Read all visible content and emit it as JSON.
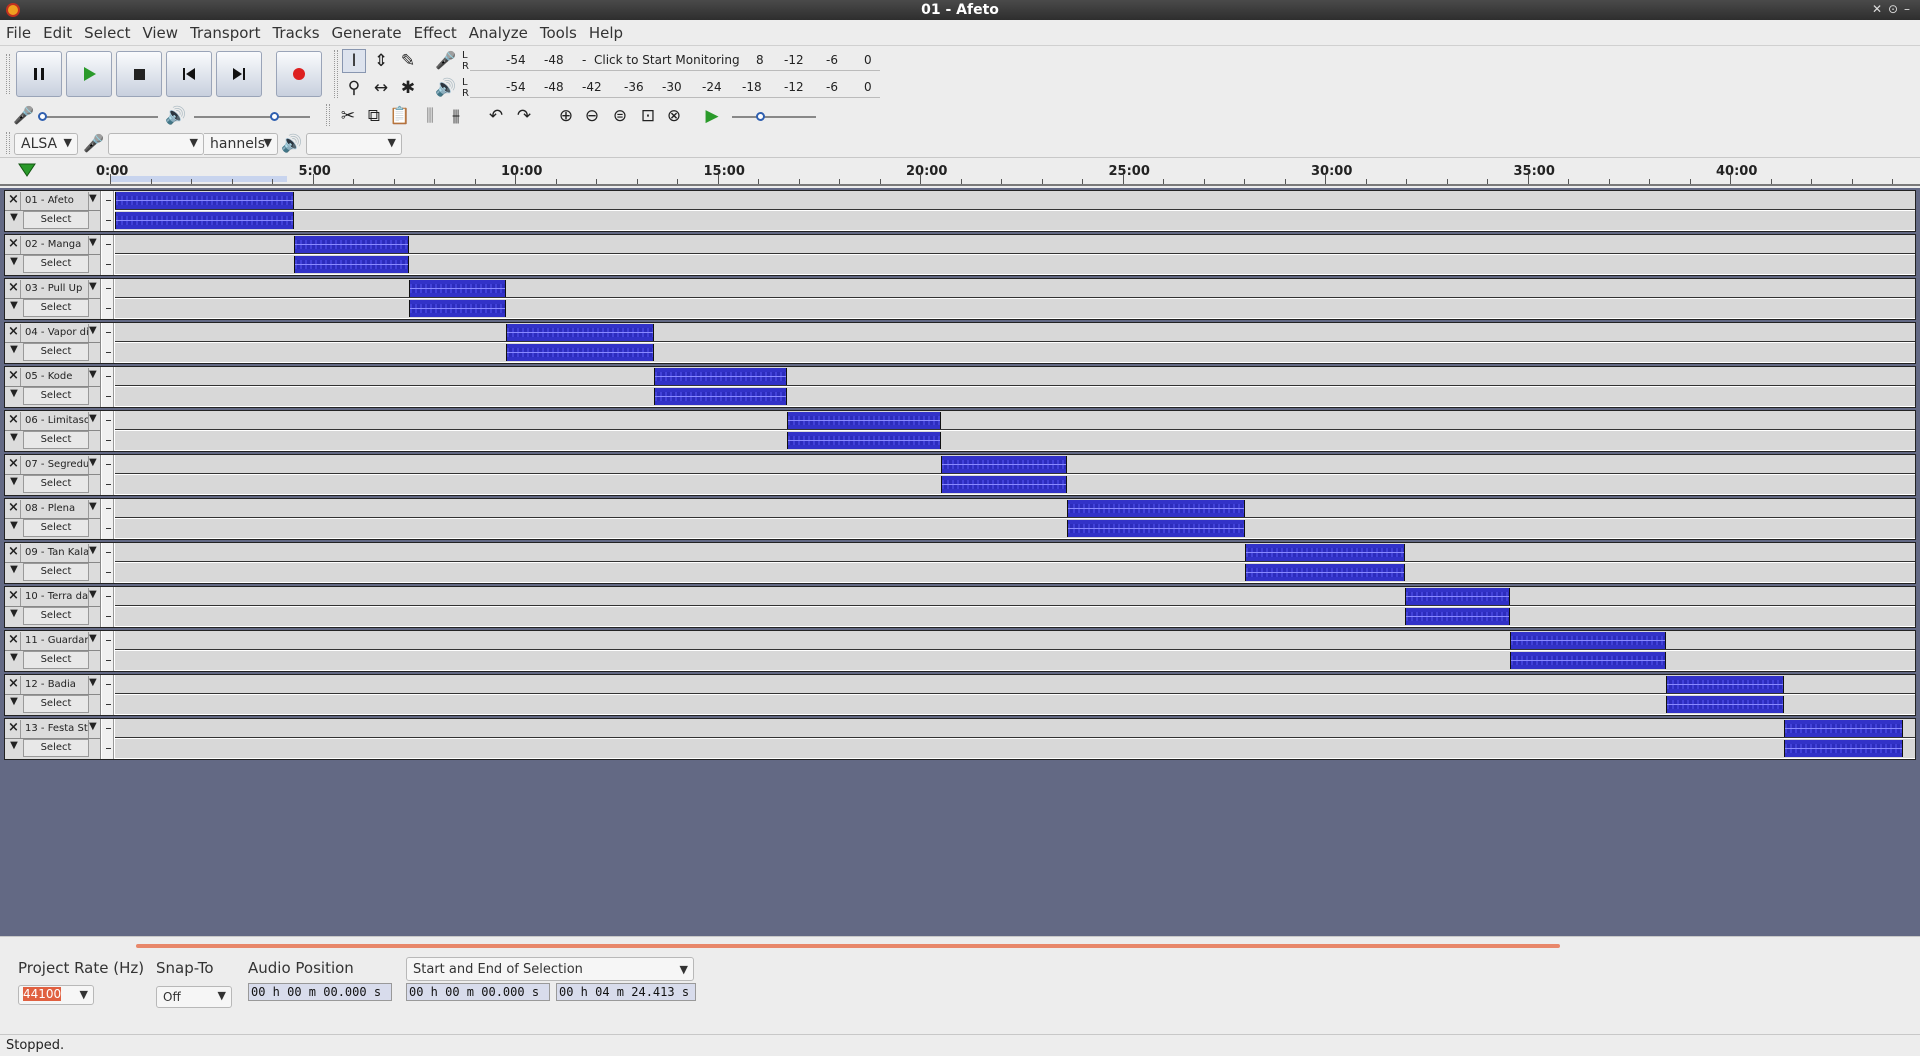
{
  "window": {
    "title": "01 - Afeto"
  },
  "menu": [
    "File",
    "Edit",
    "Select",
    "View",
    "Transport",
    "Tracks",
    "Generate",
    "Effect",
    "Analyze",
    "Tools",
    "Help"
  ],
  "meters": {
    "record_prompt": "Click to Start Monitoring",
    "record_ticks": [
      "-54",
      "-48",
      "8",
      "-12",
      "-6",
      "0"
    ],
    "playback_ticks": [
      "-54",
      "-48",
      "-42",
      "-36",
      "-30",
      "-24",
      "-18",
      "-12",
      "-6",
      "0"
    ],
    "channel_L": "L",
    "channel_R": "R"
  },
  "device": {
    "host": "ALSA",
    "channels": "hannels"
  },
  "ruler": {
    "labels": [
      "0:00",
      "5:00",
      "10:00",
      "15:00",
      "20:00",
      "25:00",
      "30:00",
      "35:00",
      "40:00"
    ],
    "total_minutes": 44.3
  },
  "tracks": [
    {
      "name": "01 - Afeto",
      "start_min": 0.0,
      "end_min": 4.41
    },
    {
      "name": "02 - Manga",
      "start_min": 4.41,
      "end_min": 7.25
    },
    {
      "name": "03 - Pull Up",
      "start_min": 7.25,
      "end_min": 9.65
    },
    {
      "name": "04 - Vapor di",
      "start_min": 9.65,
      "end_min": 13.3
    },
    {
      "name": "05 - Kode",
      "start_min": 13.3,
      "end_min": 16.6
    },
    {
      "name": "06 - Limitaso",
      "start_min": 16.6,
      "end_min": 20.4
    },
    {
      "name": "07 - Segredu",
      "start_min": 20.4,
      "end_min": 23.5
    },
    {
      "name": "08 - Plena",
      "start_min": 23.5,
      "end_min": 27.9
    },
    {
      "name": "09 - Tan Kala",
      "start_min": 27.9,
      "end_min": 31.85
    },
    {
      "name": "10 - Terra da",
      "start_min": 31.85,
      "end_min": 34.45
    },
    {
      "name": "11 - Guardar",
      "start_min": 34.45,
      "end_min": 38.3
    },
    {
      "name": "12 - Badia",
      "start_min": 38.3,
      "end_min": 41.2
    },
    {
      "name": "13 - Festa St",
      "start_min": 41.2,
      "end_min": 44.15
    }
  ],
  "track_select_label": "Select",
  "bottom": {
    "project_rate_label": "Project Rate (Hz)",
    "project_rate_value": "44100",
    "snap_to_label": "Snap-To",
    "snap_to_value": "Off",
    "audio_position_label": "Audio Position",
    "audio_position_value": "00 h 00 m 00.000 s",
    "selection_mode": "Start and End of Selection",
    "selection_start": "00 h 00 m 00.000 s",
    "selection_end": "00 h 04 m 24.413 s"
  },
  "status": "Stopped.",
  "colors": {
    "waveform": "#3232c8",
    "track_bg": "#d8d8d8",
    "workspace": "#636984",
    "accent_scroll": "#e8876a"
  }
}
